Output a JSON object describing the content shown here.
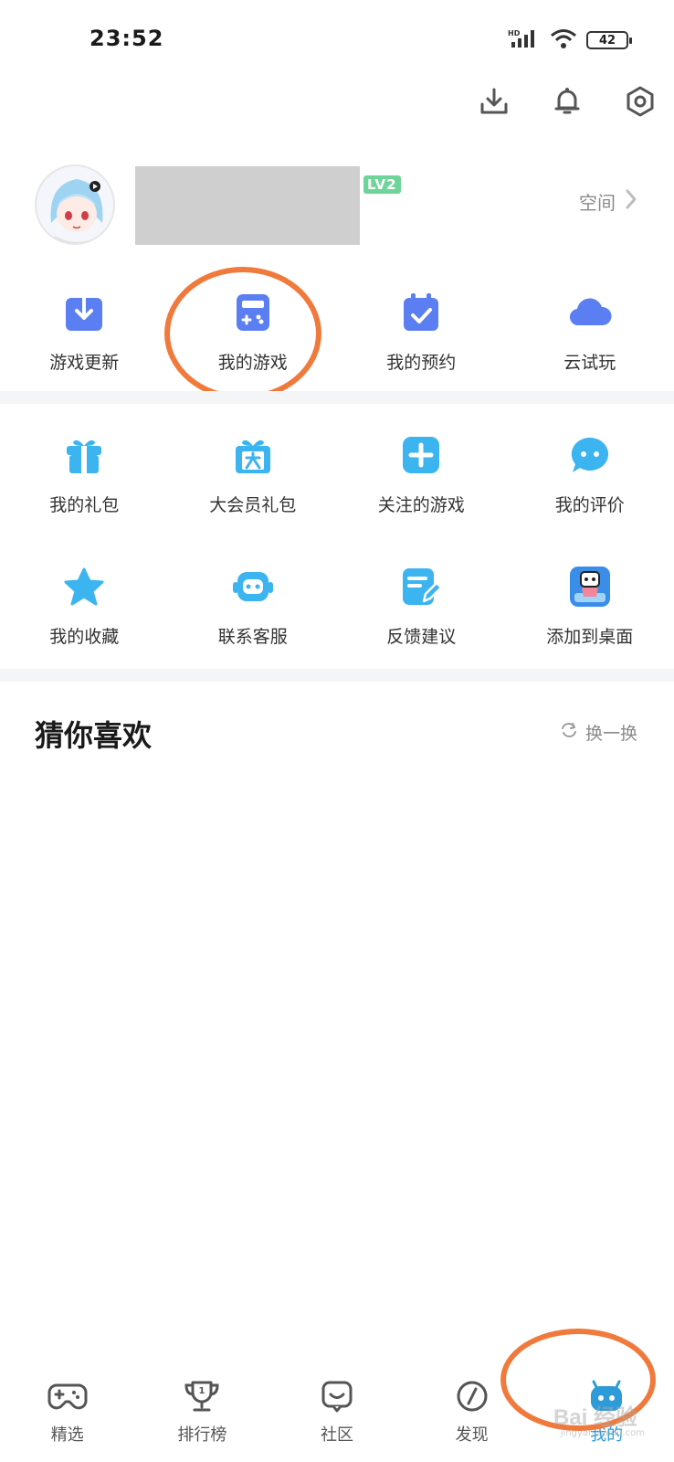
{
  "status_bar": {
    "time": "23:52",
    "network": "HD",
    "battery": "42"
  },
  "top_actions": [
    "download-icon",
    "bell-icon",
    "settings-icon"
  ],
  "profile": {
    "level": "LV2",
    "space_label": "空间"
  },
  "quick_grid": [
    {
      "label": "游戏更新",
      "icon": "download-box-icon"
    },
    {
      "label": "我的游戏",
      "icon": "gamepad-icon"
    },
    {
      "label": "我的预约",
      "icon": "calendar-check-icon"
    },
    {
      "label": "云试玩",
      "icon": "cloud-icon"
    }
  ],
  "service_grid_row1": [
    {
      "label": "我的礼包",
      "icon": "gift-icon"
    },
    {
      "label": "大会员礼包",
      "icon": "vip-gift-icon"
    },
    {
      "label": "关注的游戏",
      "icon": "plus-box-icon"
    },
    {
      "label": "我的评价",
      "icon": "chat-bubble-icon"
    }
  ],
  "service_grid_row2": [
    {
      "label": "我的收藏",
      "icon": "star-icon"
    },
    {
      "label": "联系客服",
      "icon": "robot-icon"
    },
    {
      "label": "反馈建议",
      "icon": "feedback-edit-icon"
    },
    {
      "label": "添加到桌面",
      "icon": "app-shortcut-icon"
    }
  ],
  "guess": {
    "title": "猜你喜欢",
    "refresh_label": "换一换"
  },
  "tabbar": [
    {
      "label": "精选",
      "icon": "gamepad-outline-icon"
    },
    {
      "label": "排行榜",
      "icon": "trophy-icon"
    },
    {
      "label": "社区",
      "icon": "community-icon"
    },
    {
      "label": "发现",
      "icon": "compass-icon"
    },
    {
      "label": "我的",
      "icon": "mascot-icon"
    }
  ],
  "watermark": {
    "text": "Bai 经验",
    "sub": "jingyan.baidu.com"
  },
  "colors": {
    "accent_blue": "#5b7ff2",
    "light_blue": "#3cb4ef",
    "orange_highlight": "#f07a3c",
    "divider": "#f4f5f7"
  }
}
